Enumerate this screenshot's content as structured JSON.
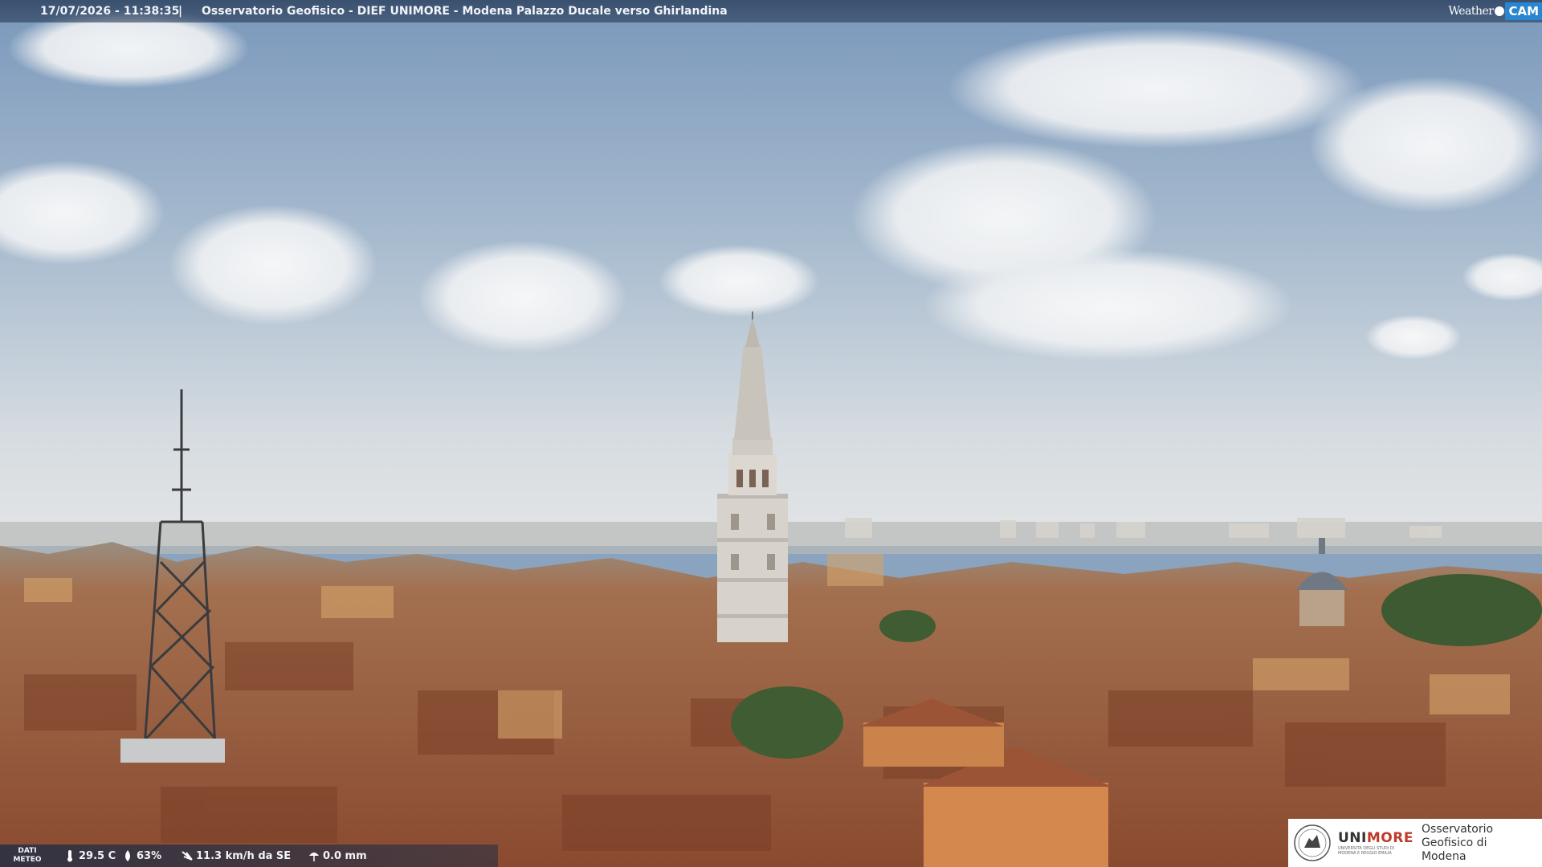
{
  "overlay": {
    "timestamp": "17/07/2026 - 11:38:35",
    "separator": "|",
    "title": "Osservatorio Geofisico - DIEF UNIMORE - Modena Palazzo Ducale verso Ghirlandina"
  },
  "brand": {
    "weather_text": "Weather",
    "cam_text": "CAM",
    "accent": "#2a86d0"
  },
  "meteo": {
    "label": "DATI\nMETEO",
    "temperature": "29.5 C",
    "humidity": "63%",
    "wind": "11.3 km/h da SE",
    "rain": "0.0 mm",
    "icons": [
      "thermometer-icon",
      "humidity-drop-icon",
      "wind-icon",
      "umbrella-icon"
    ]
  },
  "institution": {
    "name_plain": "UNI",
    "name_accent": "MORE",
    "name_small": "UNIVERSITÀ DEGLI STUDI DI MODENA E REGGIO EMILIA",
    "observatory": "Osservatorio Geofisico di Modena"
  },
  "colors": {
    "sky_top": "#7f9dbf",
    "sky_horizon": "#dfe3e6",
    "roof": "#a65a3b",
    "tower_stone": "#d9d5cf"
  }
}
